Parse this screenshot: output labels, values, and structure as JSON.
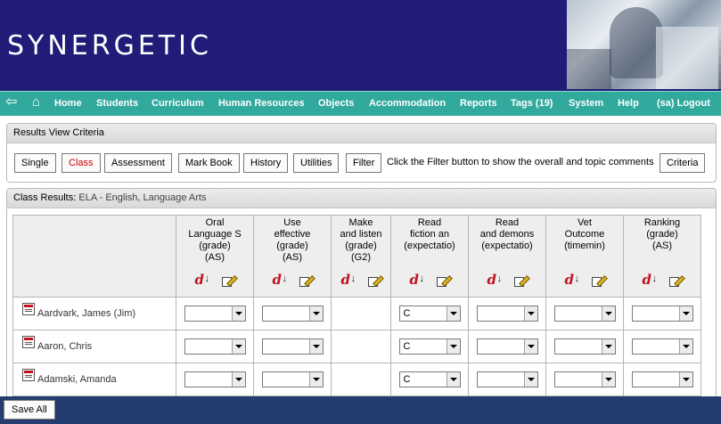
{
  "header": {
    "logo_text": "SYNERGETIC"
  },
  "nav": {
    "back_icon": "arrow-left-icon",
    "home_icon": "house-icon",
    "items": [
      "Home",
      "Students",
      "Curriculum",
      "Human Resources",
      "Objects",
      "Accommodation",
      "Reports",
      "Tags (19)",
      "System",
      "Help",
      "(sa) Logout"
    ]
  },
  "criteria": {
    "title": "Results View Criteria",
    "buttons": [
      "Single",
      "Class",
      "Assessment",
      "Mark Book",
      "History",
      "Utilities",
      "Filter"
    ],
    "active_button": "Class",
    "hint": "Click the Filter button to show the overall and topic comments",
    "criteria_button": "Criteria"
  },
  "results": {
    "title": "Class Results:",
    "subtitle": "ELA - English, Language Arts",
    "columns": [
      {
        "lines": [
          "Oral",
          "Language S",
          "(grade)",
          "(AS)"
        ]
      },
      {
        "lines": [
          "Use",
          "effective",
          "(grade)",
          "(AS)"
        ]
      },
      {
        "lines": [
          "Make",
          "and listen",
          "(grade)",
          "(G2)"
        ]
      },
      {
        "lines": [
          "Read",
          "fiction an",
          "(expectatio)"
        ]
      },
      {
        "lines": [
          "Read",
          "and demons",
          "(expectatio)"
        ]
      },
      {
        "lines": [
          "Vet",
          "Outcome",
          "(timemin)"
        ]
      },
      {
        "lines": [
          "Ranking",
          "(grade)",
          "(AS)"
        ]
      }
    ],
    "rows": [
      {
        "name": "Aardvark, James (Jim)",
        "cells": [
          "",
          "",
          null,
          "C",
          "",
          "",
          ""
        ]
      },
      {
        "name": "Aaron, Chris",
        "cells": [
          "",
          "",
          null,
          "C",
          "",
          "",
          ""
        ]
      },
      {
        "name": "Adamski, Amanda",
        "cells": [
          "",
          "",
          null,
          "C",
          "",
          "",
          ""
        ]
      }
    ]
  },
  "footer": {
    "save_all": "Save All"
  },
  "colors": {
    "header_bg": "#201c78",
    "nav_bg": "#31a99d",
    "footer_bg": "#233e6e",
    "active_text": "#cc0000"
  }
}
